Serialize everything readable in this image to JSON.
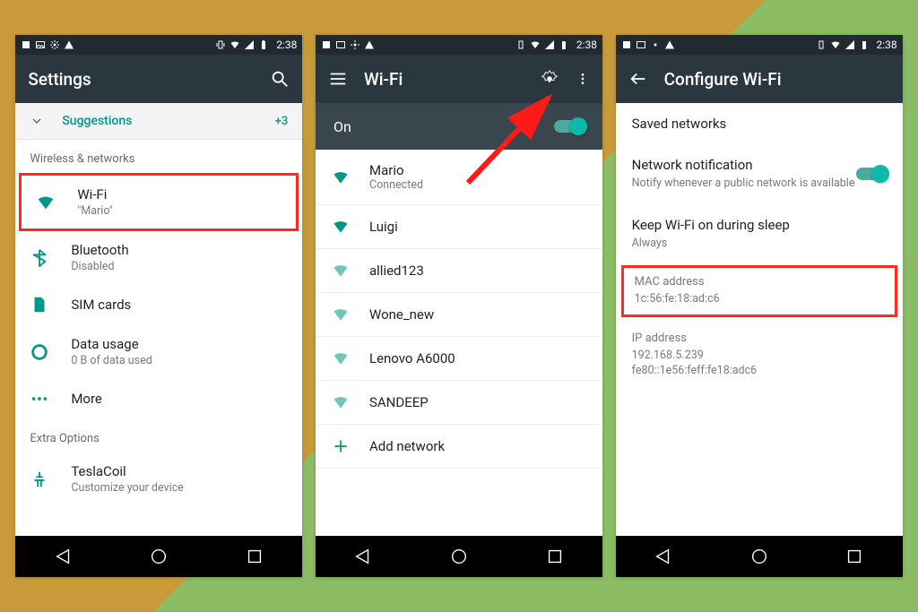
{
  "statusbar": {
    "time": "2:38"
  },
  "screen1": {
    "title": "Settings",
    "suggestions_label": "Suggestions",
    "suggestions_count": "+3",
    "section_wireless": "Wireless & networks",
    "items": [
      {
        "label": "Wi-Fi",
        "sub": "\"Mario\""
      },
      {
        "label": "Bluetooth",
        "sub": "Disabled"
      },
      {
        "label": "SIM cards",
        "sub": ""
      },
      {
        "label": "Data usage",
        "sub": "0 B of data used"
      },
      {
        "label": "More",
        "sub": ""
      }
    ],
    "section_extra": "Extra Options",
    "extra": {
      "label": "TeslaCoil",
      "sub": "Customize your device"
    }
  },
  "screen2": {
    "title": "Wi-Fi",
    "toggle_label": "On",
    "networks": [
      {
        "ssid": "Mario",
        "status": "Connected"
      },
      {
        "ssid": "Luigi",
        "status": ""
      },
      {
        "ssid": "allied123",
        "status": ""
      },
      {
        "ssid": "Wone_new",
        "status": ""
      },
      {
        "ssid": "Lenovo A6000",
        "status": ""
      },
      {
        "ssid": "SANDEEP",
        "status": ""
      }
    ],
    "add_network": "Add network"
  },
  "screen3": {
    "title": "Configure Wi-Fi",
    "saved_networks": "Saved networks",
    "notif_label": "Network notification",
    "notif_sub": "Notify whenever a public network is available",
    "sleep_label": "Keep Wi-Fi on during sleep",
    "sleep_value": "Always",
    "mac_label": "MAC address",
    "mac_value": "1c:56:fe:18:ad:c6",
    "ip_label": "IP address",
    "ip_value": "192.168.5.239\nfe80::1e56:feff:fe18:adc6"
  }
}
